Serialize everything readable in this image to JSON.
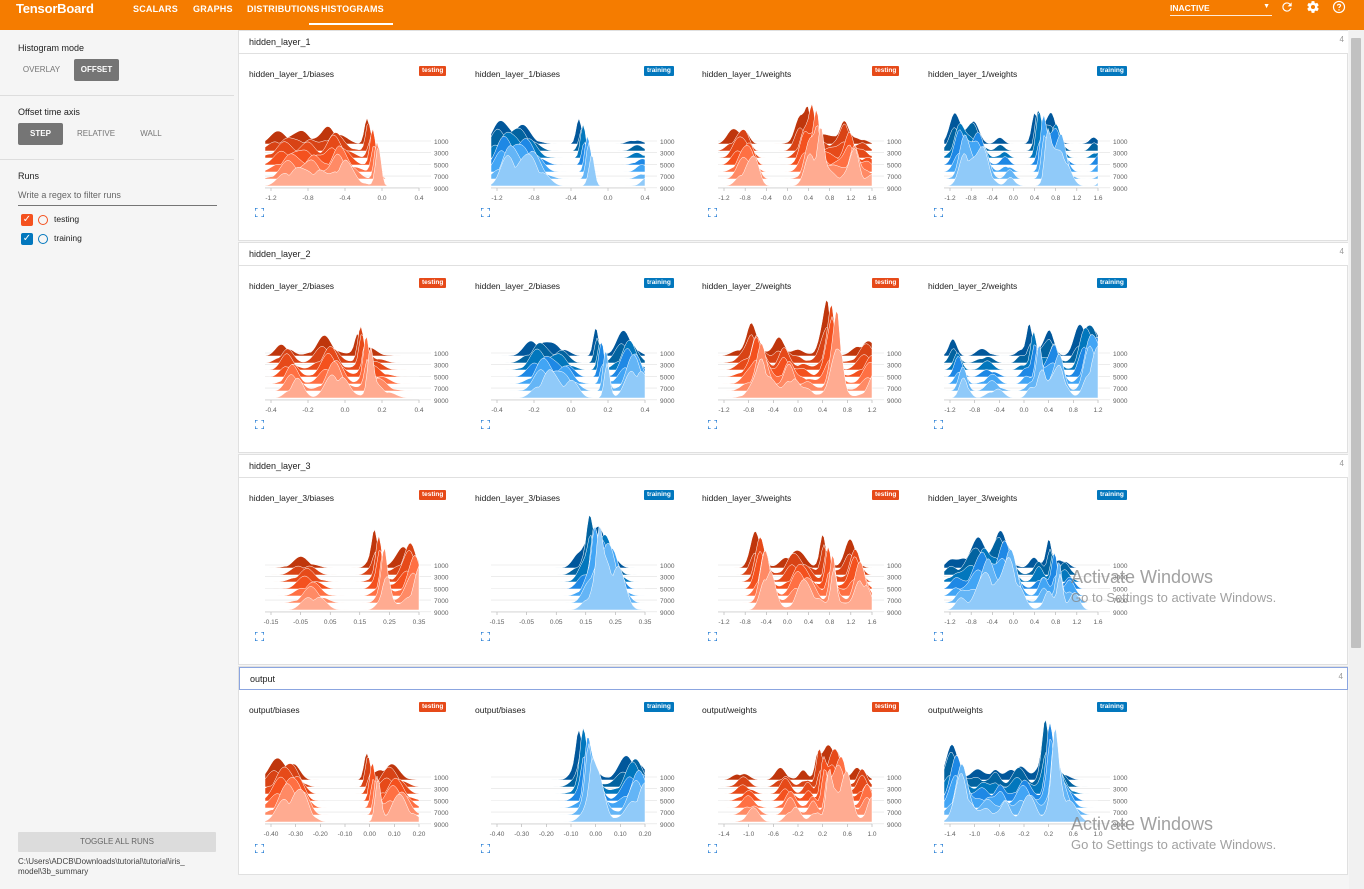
{
  "topbar": {
    "brand": "TensorBoard",
    "tabs": [
      {
        "label": "SCALARS"
      },
      {
        "label": "GRAPHS"
      },
      {
        "label": "DISTRIBUTIONS"
      },
      {
        "label": "HISTOGRAMS"
      }
    ],
    "inactive_label": "INACTIVE",
    "icons": [
      "refresh-icon",
      "gear-icon",
      "help-icon"
    ]
  },
  "sidebar": {
    "histogram_mode_title": "Histogram mode",
    "overlay_label": "OVERLAY",
    "offset_label": "OFFSET",
    "offset_axis_title": "Offset time axis",
    "step_label": "STEP",
    "relative_label": "RELATIVE",
    "wall_label": "WALL",
    "runs_title": "Runs",
    "filter_placeholder": "Write a regex to filter runs",
    "runs": [
      {
        "label": "testing",
        "color": "#f4511e"
      },
      {
        "label": "training",
        "color": "#0277bd"
      }
    ],
    "toggle_label": "TOGGLE ALL RUNS",
    "path_line1": "C:\\Users\\ADCB\\Downloads\\tutorial\\tutorial\\iris_",
    "path_line2": "model\\3b_summary"
  },
  "sections": [
    {
      "title": "hidden_layer_1",
      "count": "4",
      "cards": [
        {
          "title": "hidden_layer_1/biases",
          "run": "testing",
          "xticks": [
            "-1.2",
            "-0.8",
            "-0.4",
            "0.0",
            "0.4"
          ]
        },
        {
          "title": "hidden_layer_1/biases",
          "run": "training",
          "xticks": [
            "-1.2",
            "-0.8",
            "-0.4",
            "0.0",
            "0.4"
          ]
        },
        {
          "title": "hidden_layer_1/weights",
          "run": "testing",
          "xticks": [
            "-1.2",
            "-0.8",
            "-0.4",
            "0.0",
            "0.4",
            "0.8",
            "1.2",
            "1.6"
          ]
        },
        {
          "title": "hidden_layer_1/weights",
          "run": "training",
          "xticks": [
            "-1.2",
            "-0.8",
            "-0.4",
            "0.0",
            "0.4",
            "0.8",
            "1.2",
            "1.6"
          ]
        }
      ]
    },
    {
      "title": "hidden_layer_2",
      "count": "4",
      "cards": [
        {
          "title": "hidden_layer_2/biases",
          "run": "testing",
          "xticks": [
            "-0.4",
            "-0.2",
            "0.0",
            "0.2",
            "0.4"
          ]
        },
        {
          "title": "hidden_layer_2/biases",
          "run": "training",
          "xticks": [
            "-0.4",
            "-0.2",
            "0.0",
            "0.2",
            "0.4"
          ]
        },
        {
          "title": "hidden_layer_2/weights",
          "run": "testing",
          "xticks": [
            "-1.2",
            "-0.8",
            "-0.4",
            "0.0",
            "0.4",
            "0.8",
            "1.2"
          ]
        },
        {
          "title": "hidden_layer_2/weights",
          "run": "training",
          "xticks": [
            "-1.2",
            "-0.8",
            "-0.4",
            "0.0",
            "0.4",
            "0.8",
            "1.2"
          ]
        }
      ]
    },
    {
      "title": "hidden_layer_3",
      "count": "4",
      "cards": [
        {
          "title": "hidden_layer_3/biases",
          "run": "testing",
          "xticks": [
            "-0.15",
            "-0.05",
            "0.05",
            "0.15",
            "0.25",
            "0.35"
          ]
        },
        {
          "title": "hidden_layer_3/biases",
          "run": "training",
          "xticks": [
            "-0.15",
            "-0.05",
            "0.05",
            "0.15",
            "0.25",
            "0.35"
          ]
        },
        {
          "title": "hidden_layer_3/weights",
          "run": "testing",
          "xticks": [
            "-1.2",
            "-0.8",
            "-0.4",
            "0.0",
            "0.4",
            "0.8",
            "1.2",
            "1.6"
          ]
        },
        {
          "title": "hidden_layer_3/weights",
          "run": "training",
          "xticks": [
            "-1.2",
            "-0.8",
            "-0.4",
            "0.0",
            "0.4",
            "0.8",
            "1.2",
            "1.6"
          ]
        }
      ]
    },
    {
      "title": "output",
      "count": "4",
      "cards": [
        {
          "title": "output/biases",
          "run": "testing",
          "xticks": [
            "-0.40",
            "-0.30",
            "-0.20",
            "-0.10",
            "0.00",
            "0.10",
            "0.20"
          ]
        },
        {
          "title": "output/biases",
          "run": "training",
          "xticks": [
            "-0.40",
            "-0.30",
            "-0.20",
            "-0.10",
            "0.00",
            "0.10",
            "0.20"
          ]
        },
        {
          "title": "output/weights",
          "run": "testing",
          "xticks": [
            "-1.4",
            "-1.0",
            "-0.6",
            "-0.2",
            "0.2",
            "0.6",
            "1.0"
          ]
        },
        {
          "title": "output/weights",
          "run": "training",
          "xticks": [
            "-1.4",
            "-1.0",
            "-0.6",
            "-0.2",
            "0.2",
            "0.6",
            "1.0"
          ]
        }
      ]
    }
  ],
  "step_ticks": [
    "1000",
    "3000",
    "5000",
    "7000",
    "9000"
  ],
  "watermark": {
    "title": "Activate Windows",
    "subtitle": "Go to Settings to activate Windows."
  },
  "colors": {
    "accent": "#f57c00",
    "testing": "#f4511e",
    "training": "#0277bd"
  }
}
